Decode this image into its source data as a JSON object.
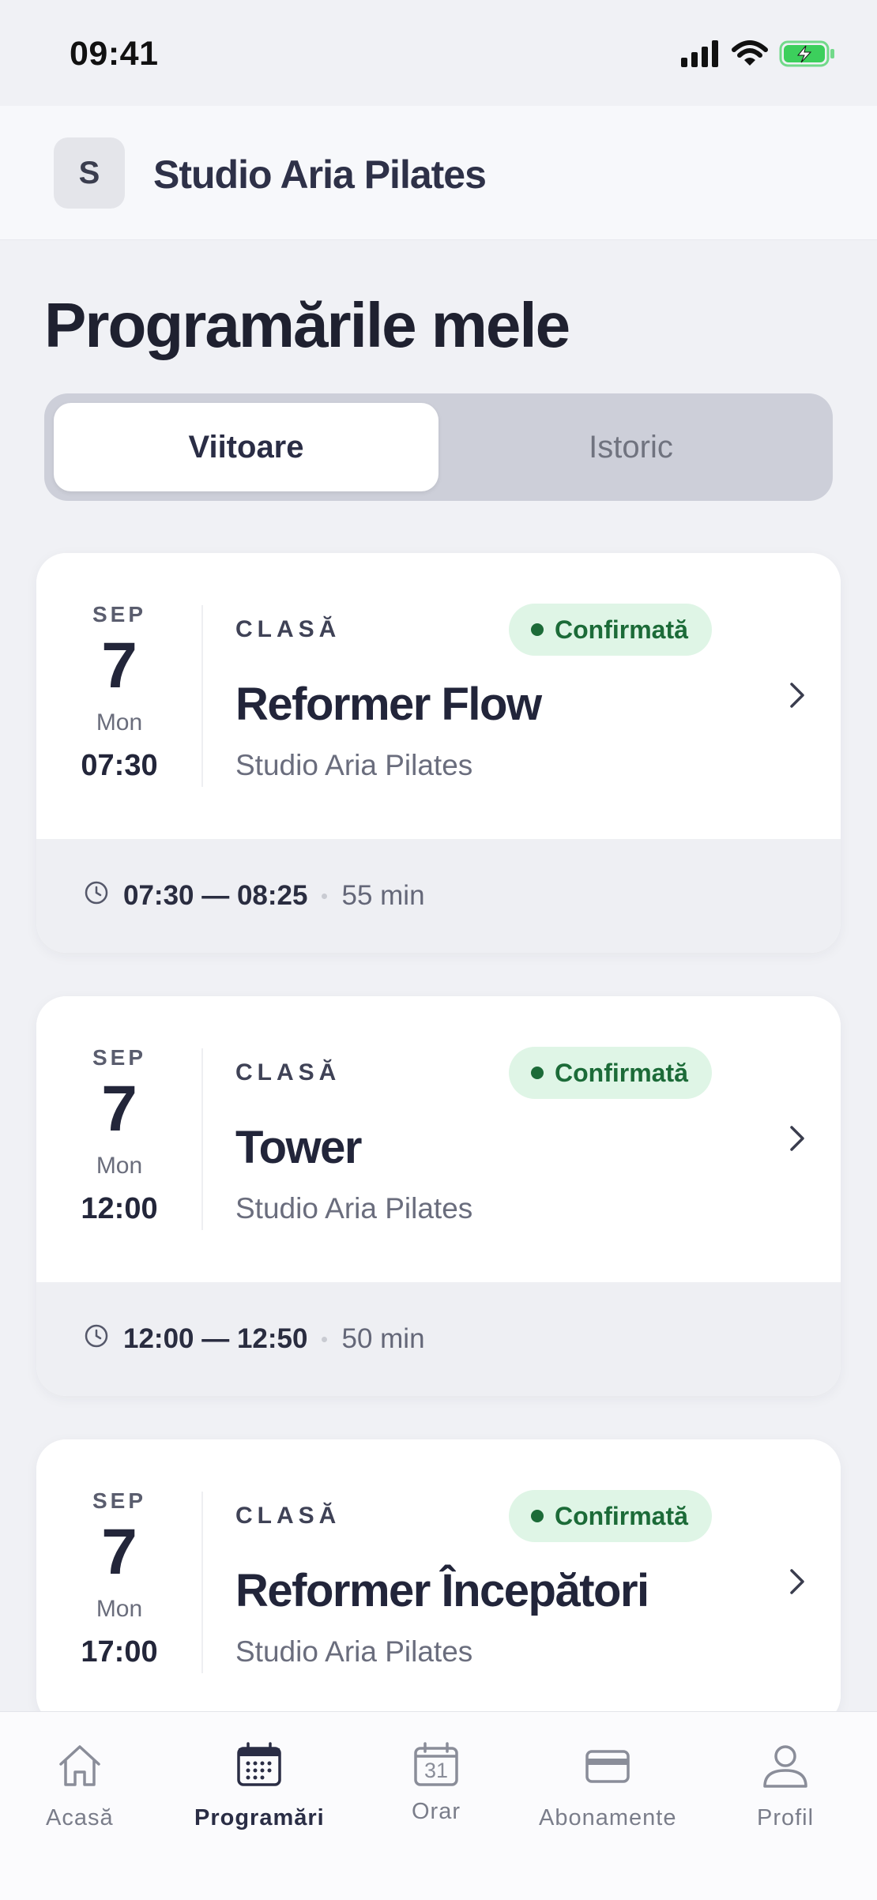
{
  "status_bar": {
    "time": "09:41"
  },
  "header": {
    "avatar_letter": "S",
    "studio_name": "Studio Aria Pilates"
  },
  "page": {
    "title": "Programările mele"
  },
  "segmented": {
    "tabs": [
      "Viitoare",
      "Istoric"
    ],
    "active": "Viitoare"
  },
  "appointments": [
    {
      "month": "SEP",
      "day": "7",
      "weekday": "Mon",
      "start": "07:30",
      "kind": "CLASĂ",
      "status": "Confirmată",
      "title": "Reformer Flow",
      "studio": "Studio Aria Pilates",
      "time_range": "07:30 — 08:25",
      "duration": "55 min"
    },
    {
      "month": "SEP",
      "day": "7",
      "weekday": "Mon",
      "start": "12:00",
      "kind": "CLASĂ",
      "status": "Confirmată",
      "title": "Tower",
      "studio": "Studio Aria Pilates",
      "time_range": "12:00 — 12:50",
      "duration": "50 min"
    },
    {
      "month": "SEP",
      "day": "7",
      "weekday": "Mon",
      "start": "17:00",
      "kind": "CLASĂ",
      "status": "Confirmată",
      "title": "Reformer Începători",
      "studio": "Studio Aria Pilates",
      "time_range": "",
      "duration": ""
    }
  ],
  "tab_bar": {
    "items": [
      {
        "label": "Acasă",
        "icon": "home-icon"
      },
      {
        "label": "Programări",
        "icon": "calendar-grid-icon"
      },
      {
        "label": "Orar",
        "icon": "calendar-31-icon"
      },
      {
        "label": "Abonamente",
        "icon": "card-icon"
      },
      {
        "label": "Profil",
        "icon": "person-icon"
      }
    ],
    "active": "Programări",
    "calendar_day": "31"
  },
  "colors": {
    "confirmed_bg": "#dff5e6",
    "confirmed_text": "#1c6b38",
    "battery_green": "#3ccf5c"
  }
}
